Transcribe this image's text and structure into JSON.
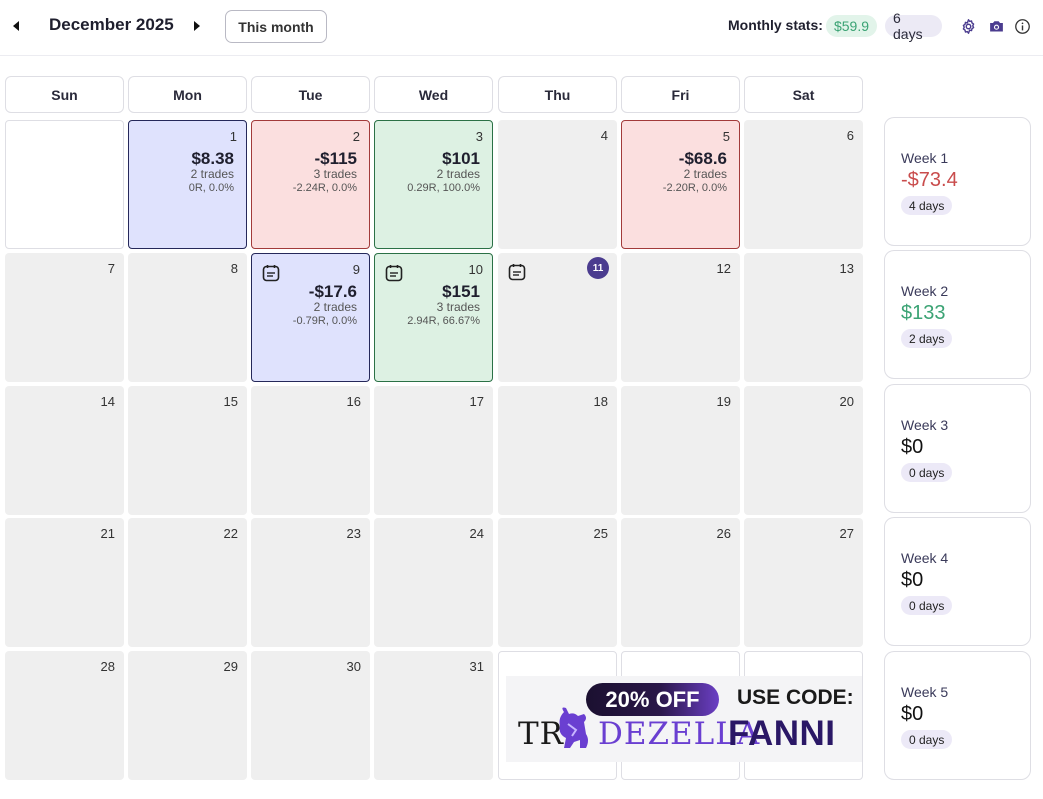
{
  "header": {
    "prev_icon": "caret-left-icon",
    "next_icon": "caret-right-icon",
    "month_title": "December 2025",
    "this_month_label": "This month",
    "stats_label": "Monthly stats:",
    "stats_value": "$59.9",
    "stats_days": "6 days",
    "icons": [
      "gear-icon",
      "camera-icon",
      "info-icon"
    ]
  },
  "weekdays": [
    "Sun",
    "Mon",
    "Tue",
    "Wed",
    "Thu",
    "Fri",
    "Sat"
  ],
  "days": [
    {
      "date": "",
      "state": "empty"
    },
    {
      "date": "1",
      "state": "blue",
      "amount": "$8.38",
      "trades": "2 trades",
      "stats": "0R, 0.0%"
    },
    {
      "date": "2",
      "state": "red",
      "amount": "-$115",
      "trades": "3 trades",
      "stats": "-2.24R, 0.0%"
    },
    {
      "date": "3",
      "state": "green",
      "amount": "$101",
      "trades": "2 trades",
      "stats": "0.29R, 100.0%"
    },
    {
      "date": "4",
      "state": "none"
    },
    {
      "date": "5",
      "state": "red",
      "amount": "-$68.6",
      "trades": "2 trades",
      "stats": "-2.20R, 0.0%"
    },
    {
      "date": "6",
      "state": "none"
    },
    {
      "date": "7",
      "state": "none"
    },
    {
      "date": "8",
      "state": "none"
    },
    {
      "date": "9",
      "state": "blue",
      "note": true,
      "amount": "-$17.6",
      "trades": "2 trades",
      "stats": "-0.79R, 0.0%"
    },
    {
      "date": "10",
      "state": "green",
      "note": true,
      "amount": "$151",
      "trades": "3 trades",
      "stats": "2.94R, 66.67%"
    },
    {
      "date": "11",
      "state": "none",
      "note": true,
      "today": true
    },
    {
      "date": "12",
      "state": "none"
    },
    {
      "date": "13",
      "state": "none"
    },
    {
      "date": "14",
      "state": "none"
    },
    {
      "date": "15",
      "state": "none"
    },
    {
      "date": "16",
      "state": "none"
    },
    {
      "date": "17",
      "state": "none"
    },
    {
      "date": "18",
      "state": "none"
    },
    {
      "date": "19",
      "state": "none"
    },
    {
      "date": "20",
      "state": "none"
    },
    {
      "date": "21",
      "state": "none"
    },
    {
      "date": "22",
      "state": "none"
    },
    {
      "date": "23",
      "state": "none"
    },
    {
      "date": "24",
      "state": "none"
    },
    {
      "date": "25",
      "state": "none"
    },
    {
      "date": "26",
      "state": "none"
    },
    {
      "date": "27",
      "state": "none"
    },
    {
      "date": "28",
      "state": "none"
    },
    {
      "date": "29",
      "state": "none"
    },
    {
      "date": "30",
      "state": "none"
    },
    {
      "date": "31",
      "state": "none"
    },
    {
      "date": "",
      "state": "empty"
    },
    {
      "date": "",
      "state": "empty"
    },
    {
      "date": "",
      "state": "empty"
    }
  ],
  "weeks": [
    {
      "label": "Week 1",
      "value": "-$73.4",
      "tone": "neg",
      "days": "4 days"
    },
    {
      "label": "Week 2",
      "value": "$133",
      "tone": "pos",
      "days": "2 days"
    },
    {
      "label": "Week 3",
      "value": "$0",
      "tone": "zero",
      "days": "0 days"
    },
    {
      "label": "Week 4",
      "value": "$0",
      "tone": "zero",
      "days": "0 days"
    },
    {
      "label": "Week 5",
      "value": "$0",
      "tone": "zero",
      "days": "0 days"
    }
  ],
  "promo": {
    "discount": "20% OFF",
    "use_code": "USE CODE:",
    "brand_a": "TR",
    "brand_b": "DEZELLA",
    "code": "FANNI"
  },
  "colors": {
    "profit": "#3ba374",
    "loss": "#c94c4c",
    "accent": "#4b3c8f",
    "blue_cell": "#dfe2fd",
    "red_cell": "#fbdfdf",
    "green_cell": "#ddf1e3"
  }
}
